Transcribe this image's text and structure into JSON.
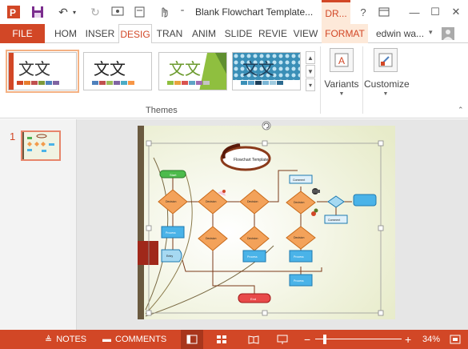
{
  "title_bar": {
    "doc_title": "Blank Flowchart Template...",
    "contextual_tab": "DR...",
    "help": "?",
    "minimize": "—",
    "restore": "☐",
    "close": "✕"
  },
  "ribbon_tabs": {
    "file": "FILE",
    "tabs": [
      "HOM",
      "INSER",
      "DESIG",
      "TRAN",
      "ANIM",
      "SLIDE",
      "REVIE",
      "VIEW",
      "FORMAT"
    ],
    "active": "DESIG",
    "user": "edwin wa...",
    "accent": "#d24726"
  },
  "ribbon": {
    "themes_label": "Themes",
    "theme_glyph": "文文",
    "variants_label": "Variants",
    "customize_label": "Customize",
    "scroll_up": "▲",
    "scroll_down": "▼",
    "more": "▾"
  },
  "thumbnails": {
    "slide_number": "1"
  },
  "slide": {
    "flowchart_title": "Flowchart Template",
    "start": "Start",
    "end": "End",
    "decision": "Decision",
    "process": "Process",
    "entry": "Entry",
    "comment": "Comment"
  },
  "status_bar": {
    "notes": "NOTES",
    "comments": "COMMENTS",
    "zoom_minus": "−",
    "zoom_plus": "+",
    "zoom": "34%"
  }
}
